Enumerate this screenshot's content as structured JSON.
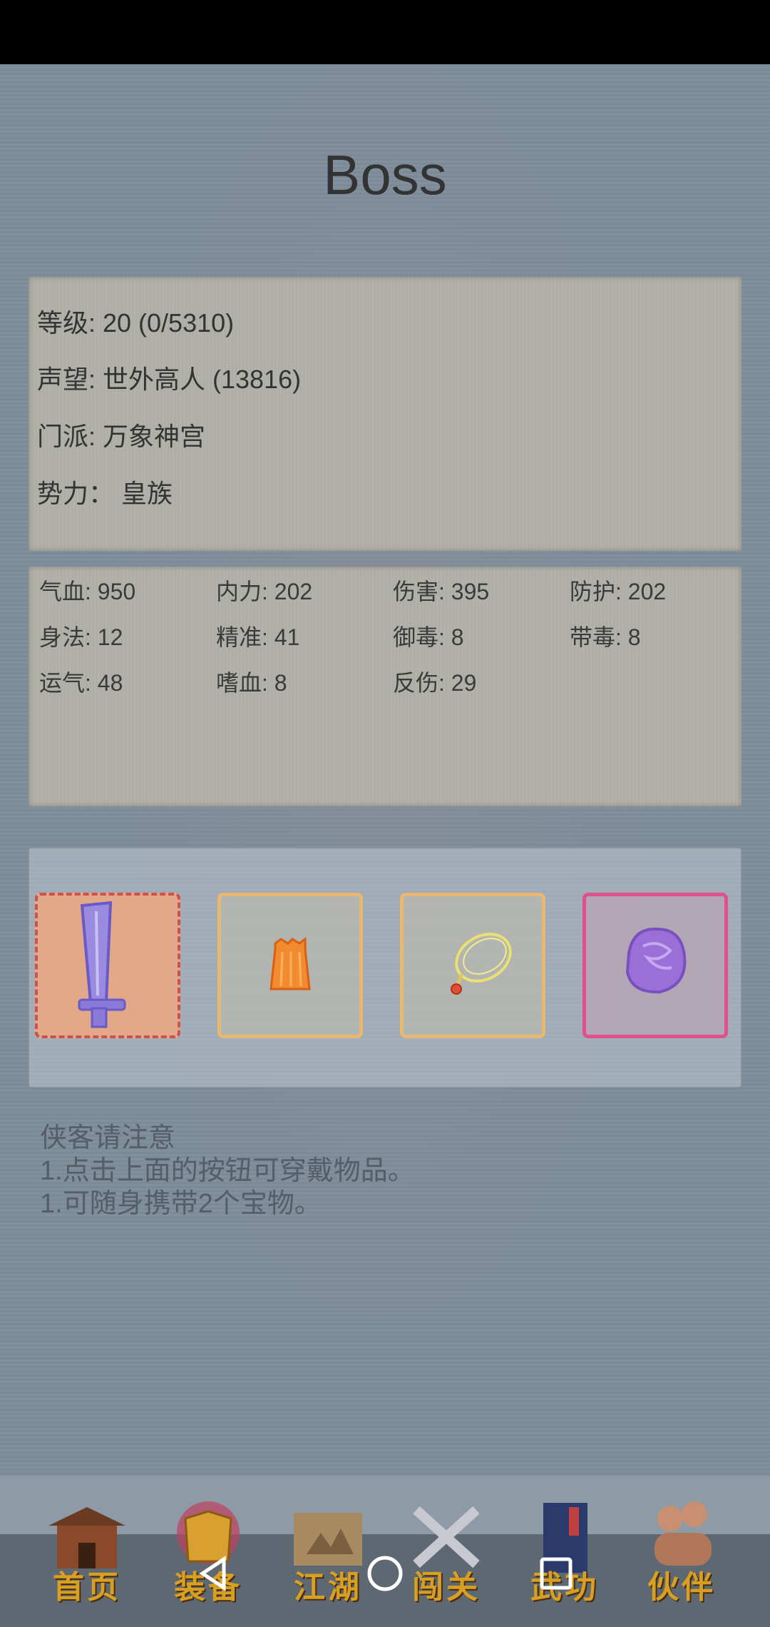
{
  "page": {
    "title": "Boss"
  },
  "info": {
    "level": "等级: 20 (0/5310)",
    "reputation": "声望: 世外高人 (13816)",
    "sect": "门派: 万象神宫",
    "faction": "势力： 皇族"
  },
  "stats": [
    "气血: 950",
    "内力: 202",
    "伤害: 395",
    "防护: 202",
    "身法: 12",
    "精准: 41",
    "御毒: 8",
    "带毒: 8",
    "运气: 48",
    "嗜血: 8",
    "反伤: 29"
  ],
  "equipment": [
    {
      "icon": "sword-icon",
      "color": "#8a7ad8"
    },
    {
      "icon": "armor-icon",
      "color": "#f08030"
    },
    {
      "icon": "necklace-icon",
      "color": "#e8d860"
    },
    {
      "icon": "orb-icon",
      "color": "#9a70d0"
    }
  ],
  "notice": {
    "heading": "侠客请注意",
    "line1": "1.点击上面的按钮可穿戴物品。",
    "line2": "1.可随身携带2个宝物。"
  },
  "nav": {
    "home": "首页",
    "equip": "装备",
    "world": "江湖",
    "stage": "闯关",
    "skill": "武功",
    "partner": "伙伴"
  }
}
